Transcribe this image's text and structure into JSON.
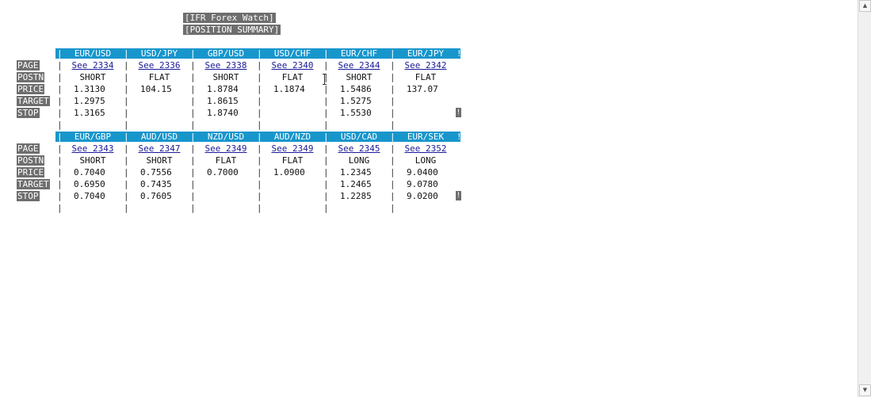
{
  "title": {
    "line1": "[IFR Forex Watch]",
    "line2": "[POSITION SUMMARY]"
  },
  "labels": [
    "PAGE",
    "POSTN",
    "PRICE",
    "TARGET",
    "STOP"
  ],
  "sections": [
    {
      "pairs": [
        "EUR/USD",
        "USD/JPY",
        "GBP/USD",
        "USD/CHF",
        "EUR/CHF",
        "EUR/JPY"
      ],
      "pages": [
        "See 2334",
        "See 2336",
        "See 2338",
        "See 2340",
        "See 2344",
        "See 2342"
      ],
      "positions": [
        "SHORT",
        "FLAT",
        "SHORT",
        "FLAT",
        "SHORT",
        "FLAT"
      ],
      "prices": [
        "1.3130",
        "104.15",
        "1.8784",
        "1.1874",
        "1.5486",
        "137.07"
      ],
      "targets": [
        "1.2975",
        "",
        "1.8615",
        "",
        "1.5275",
        ""
      ],
      "stops": [
        "1.3165",
        "",
        "1.8740",
        "",
        "1.5530",
        ""
      ]
    },
    {
      "pairs": [
        "EUR/GBP",
        "AUD/USD",
        "NZD/USD",
        "AUD/NZD",
        "USD/CAD",
        "EUR/SEK"
      ],
      "pages": [
        "See 2343",
        "See 2347",
        "See 2349",
        "See 2349",
        "See 2345",
        "See 2352"
      ],
      "positions": [
        "SHORT",
        "SHORT",
        "FLAT",
        "FLAT",
        "LONG",
        "LONG"
      ],
      "prices": [
        "0.7040",
        "0.7556",
        "0.7000",
        "1.0900",
        "1.2345",
        "9.0400"
      ],
      "targets": [
        "0.6950",
        "0.7435",
        "",
        "",
        "1.2465",
        "9.0780"
      ],
      "stops": [
        "0.7040",
        "0.7605",
        "",
        "",
        "1.2285",
        "9.0200"
      ]
    }
  ],
  "glyphs": {
    "separator": "|",
    "header_end": "!",
    "end_mark": "!"
  },
  "colors": {
    "header_band": "#1796cc",
    "label_bg": "#6e6e6e",
    "link": "#1a1a99"
  },
  "scrollbar": {
    "up_icon": "▲",
    "down_icon": "▼"
  }
}
